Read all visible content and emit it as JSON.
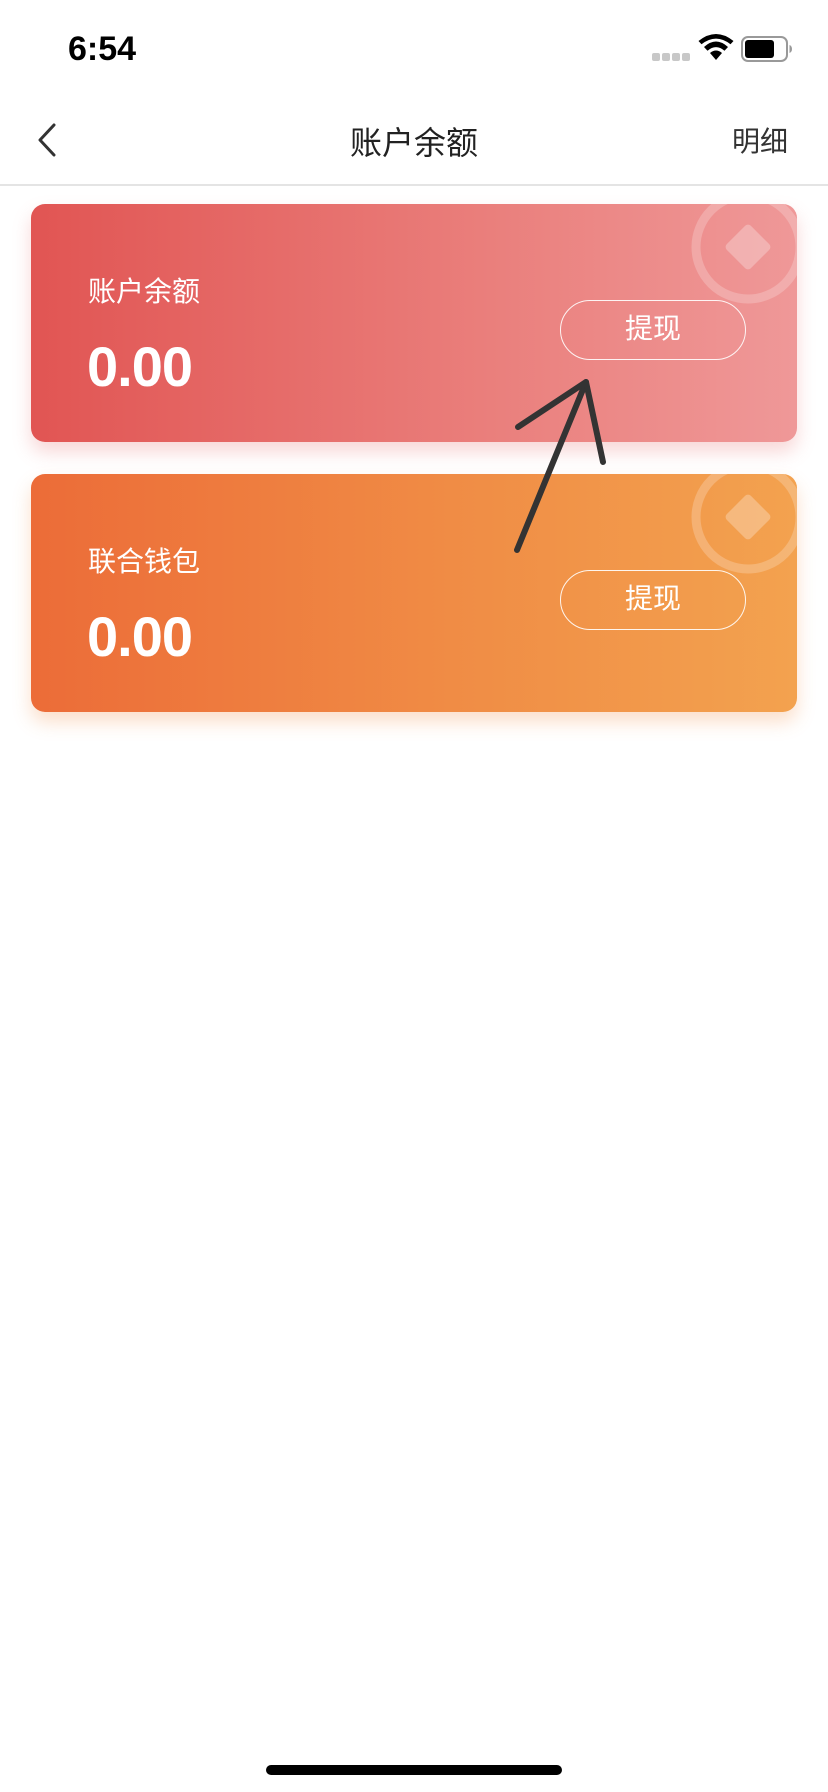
{
  "status_bar": {
    "time": "6:54"
  },
  "nav": {
    "title": "账户余额",
    "detail_label": "明细"
  },
  "cards": [
    {
      "label": "账户余额",
      "amount": "0.00",
      "button_label": "提现",
      "gradient_start": "#e15553",
      "gradient_end": "#ef9898"
    },
    {
      "label": "联合钱包",
      "amount": "0.00",
      "button_label": "提现",
      "gradient_start": "#ec6c38",
      "gradient_end": "#f3a24f"
    }
  ],
  "icons": {
    "back": "chevron-left-icon",
    "wifi": "wifi-icon",
    "battery": "battery-icon",
    "card_decoration": "coin-diamond-icon",
    "annotation": "arrow-icon"
  }
}
